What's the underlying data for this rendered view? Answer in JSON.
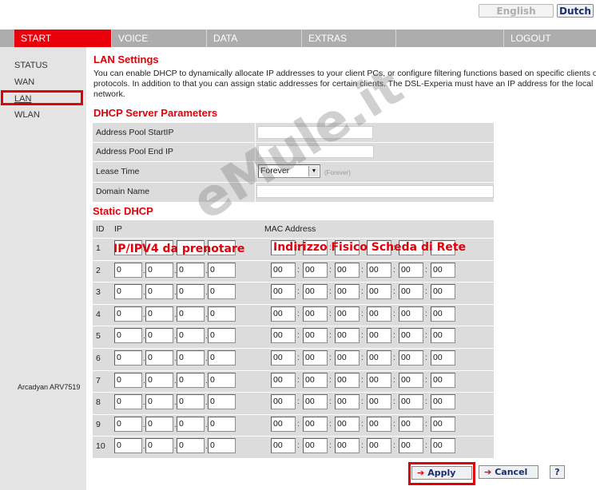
{
  "lang": {
    "english": "English",
    "dutch": "Dutch"
  },
  "nav": {
    "start": "START",
    "voice": "VOICE",
    "data": "DATA",
    "extras": "EXTRAS",
    "logout": "LOGOUT"
  },
  "sidebar": {
    "status": "STATUS",
    "wan": "WAN",
    "lan": "LAN",
    "wlan": "WLAN",
    "model": "Arcadyan ARV7519"
  },
  "lan": {
    "title": "LAN Settings",
    "desc_line1": "You can enable DHCP to dynamically allocate IP addresses to your client PCs, or configure filtering functions based on specific clients or",
    "desc_line2": "protocols. In addition to that you can assign static addresses for certain clients. The DSL-Experia must have an IP address for the local",
    "desc_line3": "network."
  },
  "dhcp": {
    "title": "DHCP Server Parameters",
    "pool_start_label": "Address Pool StartIP",
    "pool_end_label": "Address Pool End IP",
    "lease_label": "Lease Time",
    "lease_value": "Forever",
    "lease_note": "(Forever)",
    "domain_label": "Domain Name"
  },
  "static": {
    "title": "Static DHCP",
    "col_id": "ID",
    "col_ip": "IP",
    "col_mac": "MAC Address",
    "ip_value": "0",
    "mac_value": "00",
    "ip_sep": ".",
    "mac_sep": ":",
    "ids": [
      "1",
      "2",
      "3",
      "4",
      "5",
      "6",
      "7",
      "8",
      "9",
      "10"
    ]
  },
  "annotations": {
    "ip": "IP/IPV4 da prenotare",
    "mac": "Indirizzo Fisico Scheda di Rete"
  },
  "watermark": "eMule.it",
  "buttons": {
    "apply": "Apply",
    "cancel": "Cancel",
    "help": "?",
    "arrow": "➔"
  },
  "colors": {
    "accent": "#e0000a",
    "nav": "#adadad",
    "sidebar": "#e4e4e4",
    "panel": "#dcdcdc",
    "button_text": "#1a2e6e"
  }
}
